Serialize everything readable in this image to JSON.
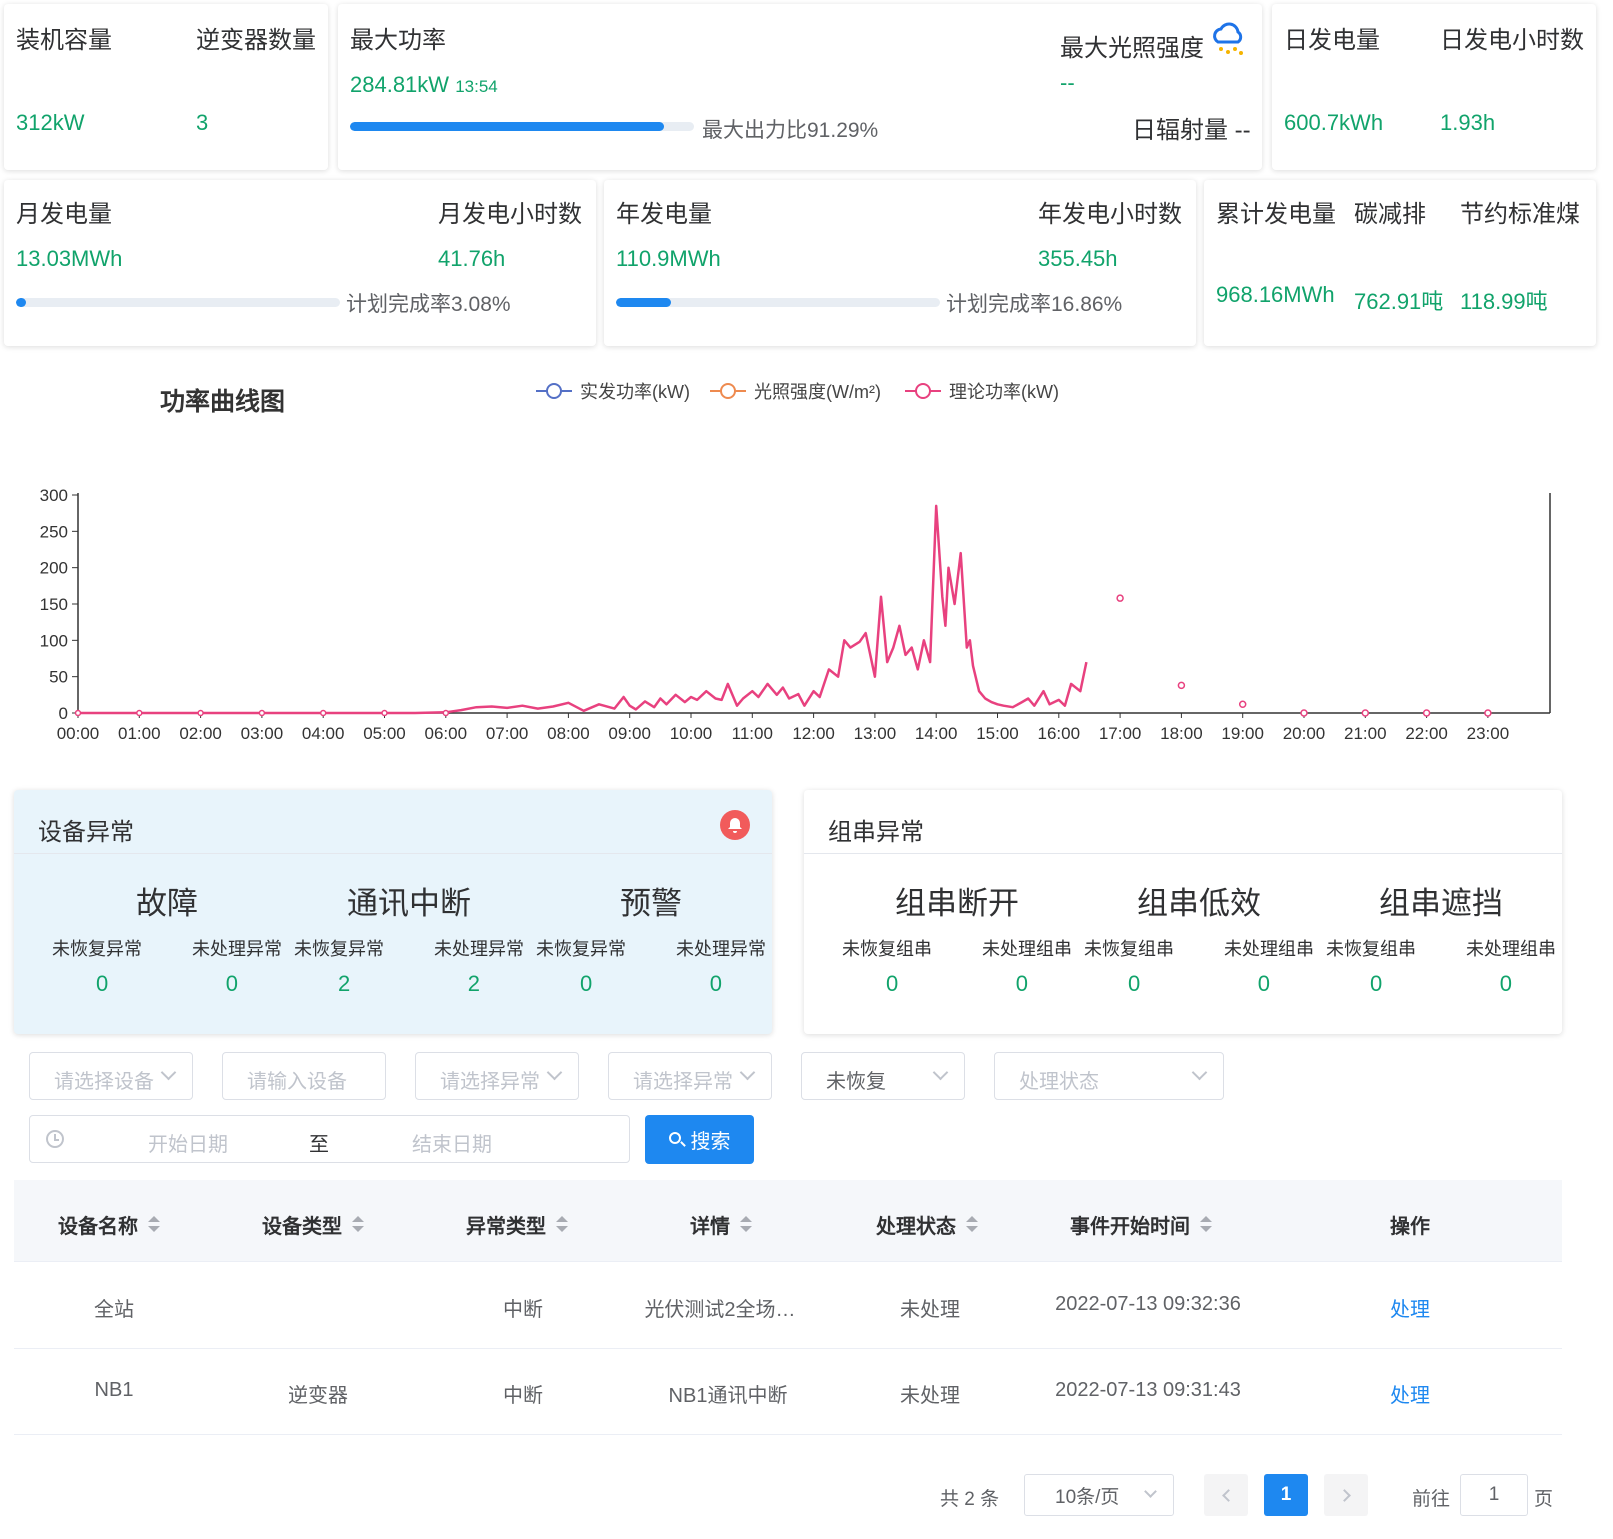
{
  "stats": {
    "capacity_label": "装机容量",
    "capacity_value": "312kW",
    "inverter_label": "逆变器数量",
    "inverter_value": "3",
    "max_power_label": "最大功率",
    "max_power_value": "284.81kW",
    "max_power_time": "13:54",
    "max_output_ratio": "最大出力比91.29%",
    "max_output_ratio_pct": 91.29,
    "max_irradiance_label": "最大光照强度",
    "max_irradiance_value": "--",
    "daily_radiation": "日辐射量 --",
    "daily_gen_label": "日发电量",
    "daily_gen_value": "600.7kWh",
    "daily_hours_label": "日发电小时数",
    "daily_hours_value": "1.93h",
    "monthly_gen_label": "月发电量",
    "monthly_gen_value": "13.03MWh",
    "monthly_hours_label": "月发电小时数",
    "monthly_hours_value": "41.76h",
    "monthly_plan": "计划完成率3.08%",
    "monthly_plan_pct": 3.08,
    "yearly_gen_label": "年发电量",
    "yearly_gen_value": "110.9MWh",
    "yearly_hours_label": "年发电小时数",
    "yearly_hours_value": "355.45h",
    "yearly_plan": "计划完成率16.86%",
    "yearly_plan_pct": 16.86,
    "total_gen_label": "累计发电量",
    "total_gen_value": "968.16MWh",
    "carbon_label": "碳减排",
    "carbon_value": "762.91吨",
    "coal_label": "节约标准煤",
    "coal_value": "118.99吨"
  },
  "chart_data": {
    "type": "line",
    "title": "功率曲线图",
    "categories": [
      "00:00",
      "01:00",
      "02:00",
      "03:00",
      "04:00",
      "05:00",
      "06:00",
      "07:00",
      "08:00",
      "09:00",
      "10:00",
      "11:00",
      "12:00",
      "13:00",
      "14:00",
      "15:00",
      "16:00",
      "17:00",
      "18:00",
      "19:00",
      "20:00",
      "21:00",
      "22:00",
      "23:00"
    ],
    "yticks": [
      0,
      50,
      100,
      150,
      200,
      250,
      300
    ],
    "ylim": [
      0,
      300
    ],
    "series": [
      {
        "name": "实发功率(kW)",
        "color": "#5470c6",
        "values": []
      },
      {
        "name": "光照强度(W/m²)",
        "color": "#ee8a4f",
        "values": []
      },
      {
        "name": "理论功率(kW)",
        "color": "#e8417f",
        "x": [
          0,
          1,
          2,
          3,
          4,
          5,
          5.5,
          6,
          6.25,
          6.5,
          6.75,
          7,
          7.25,
          7.5,
          7.75,
          8,
          8.25,
          8.5,
          8.75,
          8.9,
          9,
          9.1,
          9.25,
          9.4,
          9.5,
          9.6,
          9.75,
          9.9,
          10,
          10.1,
          10.25,
          10.4,
          10.5,
          10.6,
          10.75,
          10.85,
          11,
          11.1,
          11.25,
          11.4,
          11.5,
          11.6,
          11.75,
          11.85,
          12,
          12.1,
          12.25,
          12.4,
          12.5,
          12.6,
          12.75,
          12.85,
          13,
          13.1,
          13.2,
          13.3,
          13.4,
          13.5,
          13.6,
          13.7,
          13.8,
          13.9,
          14,
          14.1,
          14.15,
          14.2,
          14.3,
          14.4,
          14.5,
          14.55,
          14.6,
          14.7,
          14.8,
          14.9,
          15,
          15.1,
          15.25,
          15.4,
          15.5,
          15.6,
          15.75,
          15.85,
          16,
          16.1,
          16.2,
          16.35,
          16.45
        ],
        "values": [
          0,
          0,
          0,
          0,
          0,
          0,
          0,
          1,
          4,
          8,
          9,
          7,
          10,
          6,
          9,
          14,
          3,
          12,
          6,
          22,
          10,
          5,
          16,
          8,
          20,
          12,
          25,
          15,
          22,
          18,
          30,
          20,
          18,
          40,
          10,
          20,
          30,
          22,
          40,
          25,
          35,
          20,
          26,
          10,
          30,
          22,
          60,
          50,
          100,
          90,
          98,
          110,
          50,
          160,
          70,
          90,
          120,
          80,
          90,
          60,
          100,
          70,
          285,
          160,
          120,
          200,
          150,
          220,
          90,
          100,
          65,
          30,
          20,
          15,
          12,
          10,
          8,
          15,
          20,
          10,
          30,
          12,
          18,
          10,
          40,
          30,
          70
        ]
      }
    ],
    "points": [
      {
        "x": 17,
        "y": 158
      },
      {
        "x": 18,
        "y": 38
      },
      {
        "x": 19,
        "y": 12
      },
      {
        "x": 20,
        "y": 0
      },
      {
        "x": 21,
        "y": 0
      },
      {
        "x": 22,
        "y": 0
      },
      {
        "x": 23,
        "y": 0
      }
    ]
  },
  "device_alarm": {
    "title": "设备异常",
    "groups": [
      {
        "title": "故障",
        "l1": "未恢复异常",
        "l2": "未处理异常",
        "v1": "0",
        "v2": "0"
      },
      {
        "title": "通讯中断",
        "l1": "未恢复异常",
        "l2": "未处理异常",
        "v1": "2",
        "v2": "2"
      },
      {
        "title": "预警",
        "l1": "未恢复异常",
        "l2": "未处理异常",
        "v1": "0",
        "v2": "0"
      }
    ]
  },
  "string_alarm": {
    "title": "组串异常",
    "groups": [
      {
        "title": "组串断开",
        "l1": "未恢复组串",
        "l2": "未处理组串",
        "v1": "0",
        "v2": "0"
      },
      {
        "title": "组串低效",
        "l1": "未恢复组串",
        "l2": "未处理组串",
        "v1": "0",
        "v2": "0"
      },
      {
        "title": "组串遮挡",
        "l1": "未恢复组串",
        "l2": "未处理组串",
        "v1": "0",
        "v2": "0"
      }
    ]
  },
  "filters": {
    "device_select": "请选择设备",
    "device_input": "请输入设备",
    "alarm_select_1": "请选择异常",
    "alarm_select_2": "请选择异常",
    "recovery_status": "未恢复",
    "process_status": "处理状态",
    "start_date": "开始日期",
    "to": "至",
    "end_date": "结束日期",
    "search_label": "搜索"
  },
  "table": {
    "headers": [
      "设备名称",
      "设备类型",
      "异常类型",
      "详情",
      "处理状态",
      "事件开始时间",
      "操作"
    ],
    "rows": [
      {
        "name": "全站",
        "type": "",
        "alarm": "中断",
        "detail": "光伏测试2全场…",
        "status": "未处理",
        "time": "2022-07-13 09:32:36",
        "action": "处理"
      },
      {
        "name": "NB1",
        "type": "逆变器",
        "alarm": "中断",
        "detail": "NB1通讯中断",
        "status": "未处理",
        "time": "2022-07-13 09:31:43",
        "action": "处理"
      }
    ]
  },
  "pagination": {
    "total": "共 2 条",
    "page_size": "10条/页",
    "current": "1",
    "goto_label": "前往",
    "goto_value": "1",
    "page_unit": "页"
  }
}
